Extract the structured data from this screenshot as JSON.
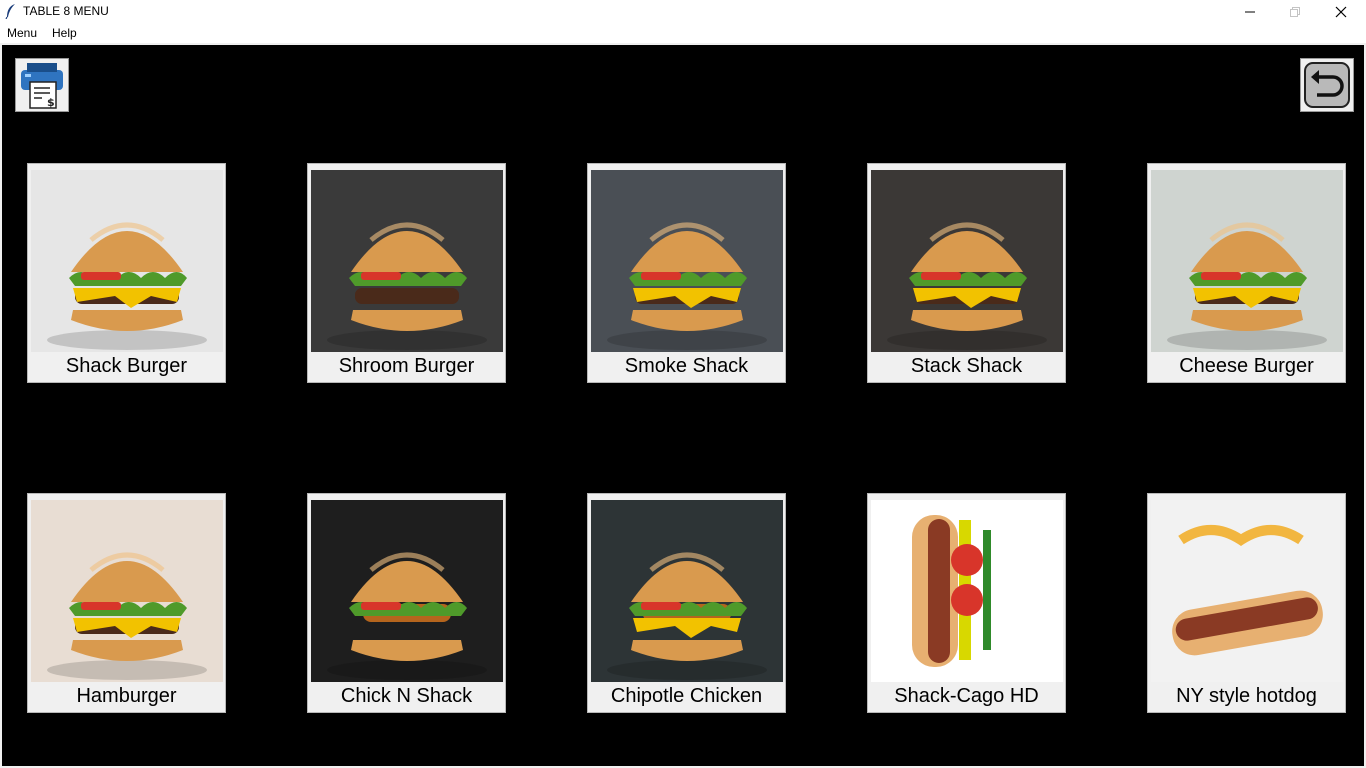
{
  "window": {
    "title": "TABLE 8 MENU",
    "minimize_glyph": "—",
    "close_glyph": "✕"
  },
  "menubar": {
    "items": [
      "Menu",
      "Help"
    ]
  },
  "toolbar": {
    "print_icon": "printer-bill-icon",
    "back_icon": "back-arrow-icon"
  },
  "menu_items": [
    {
      "label": "Shack Burger",
      "kind": "burger"
    },
    {
      "label": "Shroom Burger",
      "kind": "burger"
    },
    {
      "label": "Smoke Shack",
      "kind": "burger"
    },
    {
      "label": "Stack Shack",
      "kind": "burger"
    },
    {
      "label": "Cheese Burger",
      "kind": "burger"
    },
    {
      "label": "Hamburger",
      "kind": "burger"
    },
    {
      "label": "Chick N Shack",
      "kind": "burger"
    },
    {
      "label": "Chipotle Chicken",
      "kind": "burger"
    },
    {
      "label": "Shack-Cago HD",
      "kind": "hotdog"
    },
    {
      "label": "NY style hotdog",
      "kind": "hotdog"
    }
  ],
  "colors": {
    "content_bg": "#000000",
    "card_bg": "#f0f0f0",
    "bun": "#d99a4e",
    "patty": "#4a2a1a",
    "cheese": "#f2c200",
    "lettuce": "#4f9a2a",
    "tomato": "#d8352a"
  }
}
